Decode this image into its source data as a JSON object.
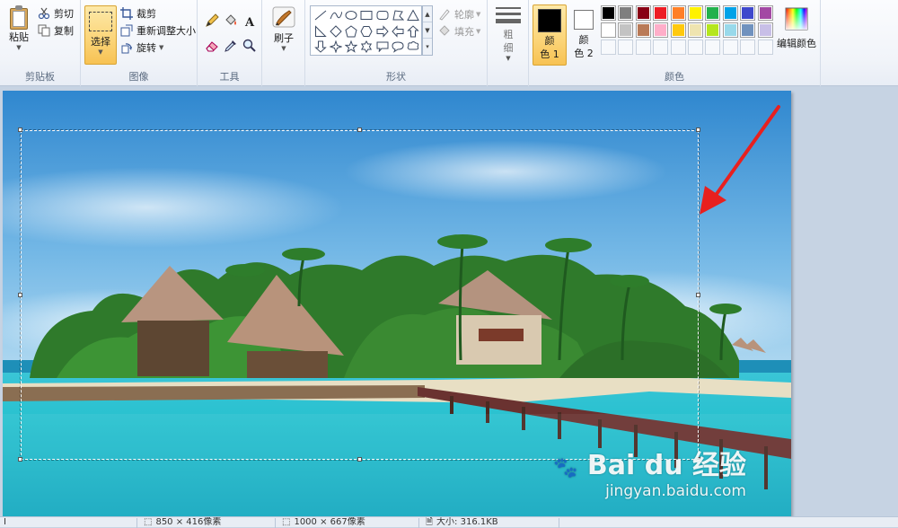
{
  "clipboard": {
    "paste": "粘贴",
    "cut": "剪切",
    "copy": "复制",
    "label": "剪贴板"
  },
  "image": {
    "select": "选择",
    "crop": "裁剪",
    "resize": "重新调整大小",
    "rotate": "旋转",
    "label": "图像"
  },
  "tools": {
    "label": "工具",
    "text_glyph": "A"
  },
  "brushes": {
    "label": "刷子"
  },
  "shapes": {
    "outline": "轮廓",
    "fill": "填充",
    "label": "形状"
  },
  "size": {
    "label_line1": "粗",
    "label_line2": "细"
  },
  "colors": {
    "color1_line1": "颜",
    "color1_line2": "色 1",
    "color2_line1": "颜",
    "color2_line2": "色 2",
    "edit": "编辑颜色",
    "label": "颜色",
    "color1_value": "#000000",
    "color2_value": "#ffffff",
    "palette_row1": [
      "#000000",
      "#7f7f7f",
      "#880015",
      "#ed1c24",
      "#ff7f27",
      "#fff200",
      "#22b14c",
      "#00a2e8",
      "#3f48cc",
      "#a349a4"
    ],
    "palette_row2": [
      "#ffffff",
      "#c3c3c3",
      "#b97a57",
      "#ffaec9",
      "#ffc90e",
      "#efe4b0",
      "#b5e61d",
      "#99d9ea",
      "#7092be",
      "#c8bfe7"
    ]
  },
  "status": {
    "cursor": "I",
    "selection_size": "850 × 416像素",
    "image_size": "1000 × 667像素",
    "file_size": "大小: 316.1KB"
  },
  "watermark": {
    "brand": "Bai du",
    "brand_cn": "经验",
    "url": "jingyan.baidu.com"
  },
  "accent": {
    "annotation_arrow": "#e8201f",
    "select_active": "#fbd477"
  }
}
